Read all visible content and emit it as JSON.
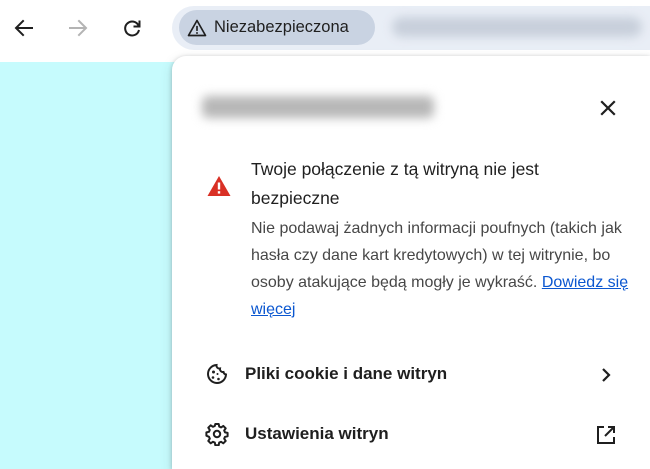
{
  "toolbar": {
    "back_icon": "arrow-left-icon",
    "forward_icon": "arrow-right-icon",
    "reload_icon": "reload-icon",
    "security_chip": {
      "icon": "warning-triangle-icon",
      "label": "Niezabezpieczona"
    }
  },
  "popup": {
    "close_icon": "close-icon",
    "warning": {
      "icon": "warning-triangle-icon",
      "icon_color": "#d93025",
      "title": "Twoje połączenie z tą witryną nie jest bezpieczne",
      "body": "Nie podawaj żadnych informacji poufnych (takich jak hasła czy dane kart kredytowych) w tej witrynie, bo osoby atakujące będą mogły je wykraść.",
      "learn_more": "Dowiedz się więcej"
    },
    "rows": [
      {
        "icon": "cookie-icon",
        "label": "Pliki cookie i dane witryn",
        "trail_icon": "chevron-right-icon"
      },
      {
        "icon": "gear-icon",
        "label": "Ustawienia witryn",
        "trail_icon": "open-in-new-icon"
      }
    ]
  },
  "colors": {
    "page_background": "#c6fbfd",
    "link": "#0b57d0",
    "chip_background": "#c9d3e2"
  }
}
